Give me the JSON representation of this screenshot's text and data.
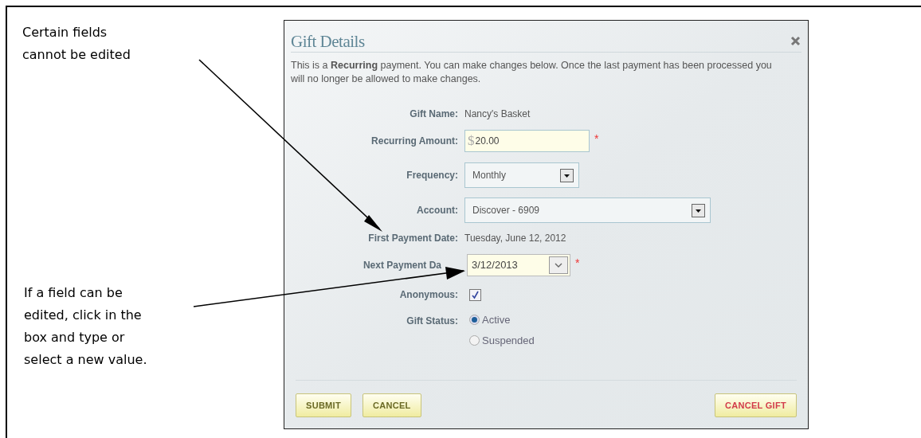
{
  "annotations": [
    {
      "text": "Certain fields\ncannot be edited"
    },
    {
      "text": "If a field can be\nedited, click in the\nbox and type or\nselect a new value."
    }
  ],
  "dialog": {
    "title": "Gift Details",
    "description": "This is a **Recurring** payment. You can make changes below. Once the last payment has been processed you will no longer be allowed to make changes.",
    "fields": [
      {
        "kind": "text",
        "label": "Gift Name:",
        "value": "Nancy's Basket"
      },
      {
        "kind": "input",
        "label": "Recurring Amount:",
        "prefix": "$",
        "value": "20.00",
        "required_mark": "*"
      },
      {
        "kind": "select",
        "label": "Frequency:",
        "value": "Monthly",
        "wide": false
      },
      {
        "kind": "select",
        "label": "Account:",
        "value": "Discover - 6909",
        "wide": true
      },
      {
        "kind": "text",
        "label": "First Payment Date:",
        "value": "Tuesday, June 12, 2012"
      },
      {
        "kind": "date",
        "label": "Next Payment Da",
        "value": "3/12/2013",
        "required_mark": "*"
      },
      {
        "kind": "checkbox",
        "label": "Anonymous:",
        "checked": true
      },
      {
        "kind": "radio",
        "label": "Gift Status:",
        "options": [
          {
            "label": "Active",
            "selected": true
          },
          {
            "label": "Suspended",
            "selected": false
          }
        ]
      }
    ],
    "buttons": [
      {
        "label": "SUBMIT",
        "danger": false
      },
      {
        "label": "CANCEL",
        "danger": false
      },
      {
        "label": "CANCEL GIFT",
        "danger": true
      }
    ]
  }
}
